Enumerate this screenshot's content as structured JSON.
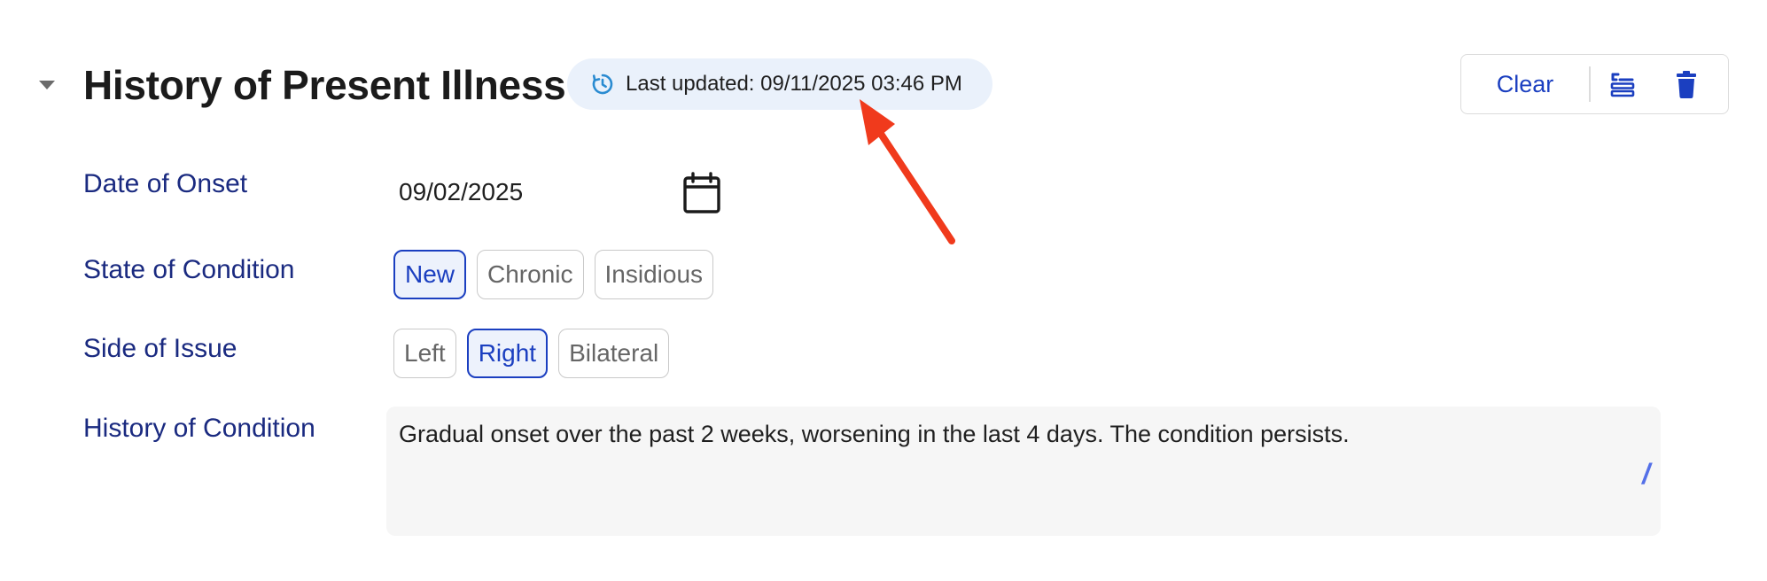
{
  "section": {
    "title": "History of Present Illness",
    "last_updated": "Last updated: 09/11/2025 03:46 PM"
  },
  "toolbar": {
    "clear_label": "Clear"
  },
  "fields": {
    "date_of_onset": {
      "label": "Date of Onset",
      "value": "09/02/2025"
    },
    "state_of_condition": {
      "label": "State of Condition",
      "options": [
        "New",
        "Chronic",
        "Insidious"
      ],
      "selected": "New"
    },
    "side_of_issue": {
      "label": "Side of Issue",
      "options": [
        "Left",
        "Right",
        "Bilateral"
      ],
      "selected": "Right"
    },
    "history_of_condition": {
      "label": "History of Condition",
      "value": "Gradual onset over the past 2 weeks, worsening in the last 4 days. The condition persists.",
      "shortcut": "/"
    }
  },
  "icons": {
    "collapse": "caret-down-icon",
    "updated": "history-clock-icon",
    "template": "list-template-icon",
    "delete": "trash-icon",
    "calendar": "calendar-icon"
  },
  "colors": {
    "accent": "#1b3fc0",
    "label": "#1a2a80",
    "pill_background": "#eaf1fb",
    "chip_selected_background": "#edf2fc",
    "annotation_arrow": "#f03a1c"
  }
}
